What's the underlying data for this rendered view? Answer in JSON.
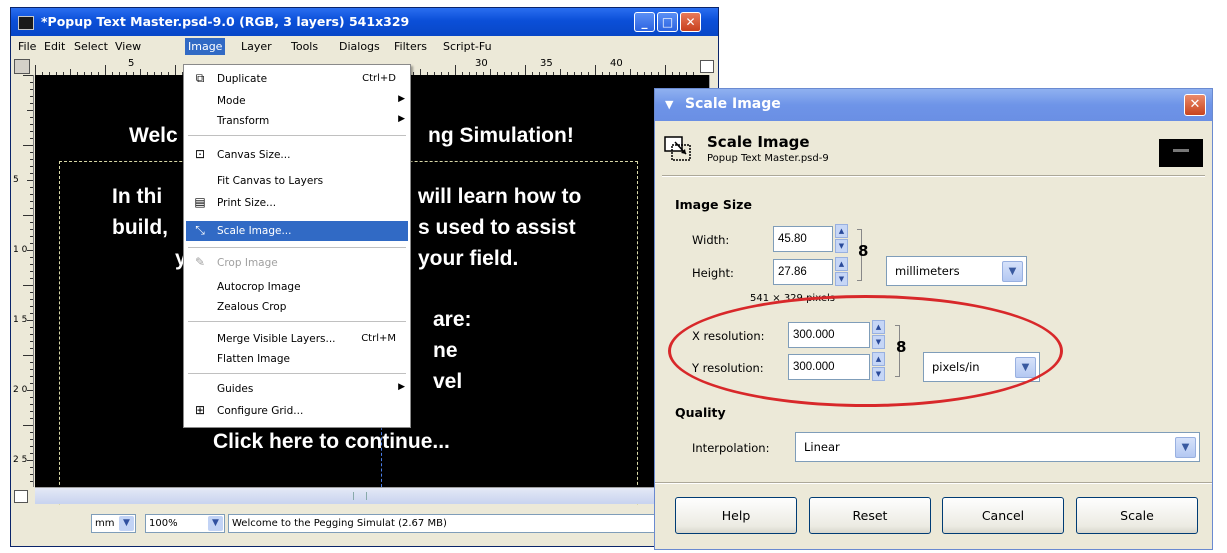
{
  "gimp_window": {
    "title": "*Popup Text Master.psd-9.0 (RGB, 3 layers) 541x329",
    "menu": [
      "File",
      "Edit",
      "Select",
      "View",
      "Image",
      "Layer",
      "Tools",
      "Dialogs",
      "Filters",
      "Script-Fu"
    ],
    "active_menu": "Image",
    "ruler_labels": [
      "5",
      "30",
      "35",
      "40"
    ],
    "left_ruler_labels": [
      "5",
      "1 0",
      "1 5",
      "2 0",
      "2 5"
    ],
    "canvas_lines": [
      "Welc",
      "ng Simulation!",
      "In thi",
      "will learn how to",
      "build,",
      "s used to assist",
      "y",
      "your field.",
      "are:",
      "ne",
      "vel",
      "Click here to continue..."
    ],
    "status": {
      "unit": "mm",
      "zoom": "100%",
      "message": "Welcome to the Pegging Simulat (2.67 MB)"
    }
  },
  "image_menu": {
    "items": [
      {
        "label": "Duplicate",
        "shortcut": "Ctrl+D",
        "icon": "duplicate-icon",
        "glyph": "⧉"
      },
      {
        "label": "Mode",
        "submenu": true
      },
      {
        "label": "Transform",
        "submenu": true
      },
      {
        "label": "Canvas Size...",
        "icon": "canvas-size-icon",
        "glyph": "⊡"
      },
      {
        "label": "Fit Canvas to Layers"
      },
      {
        "label": "Print Size...",
        "icon": "print-size-icon",
        "glyph": "▤"
      },
      {
        "label": "Scale Image...",
        "icon": "scale-image-icon",
        "glyph": "⤡",
        "highlighted": true
      },
      {
        "label": "Crop Image",
        "icon": "crop-icon",
        "glyph": "✎",
        "disabled": true
      },
      {
        "label": "Autocrop Image"
      },
      {
        "label": "Zealous Crop"
      },
      {
        "label": "Merge Visible Layers...",
        "shortcut": "Ctrl+M"
      },
      {
        "label": "Flatten Image"
      },
      {
        "label": "Guides",
        "submenu": true
      },
      {
        "label": "Configure Grid...",
        "icon": "grid-icon",
        "glyph": "⊞"
      }
    ]
  },
  "scale_dialog": {
    "title": "Scale Image",
    "header_title": "Scale Image",
    "header_subtitle": "Popup Text Master.psd-9",
    "image_size_label": "Image Size",
    "width_label": "Width:",
    "width_value": "45.80",
    "height_label": "Height:",
    "height_value": "27.86",
    "size_unit": "millimeters",
    "pixel_info": "541 × 329 pixels",
    "x_res_label": "X resolution:",
    "x_res_value": "300.000",
    "y_res_label": "Y resolution:",
    "y_res_value": "300.000",
    "res_unit": "pixels/in",
    "quality_label": "Quality",
    "interp_label": "Interpolation:",
    "interp_value": "Linear",
    "buttons": {
      "help": "Help",
      "reset": "Reset",
      "cancel": "Cancel",
      "scale": "Scale"
    }
  },
  "colors": {
    "highlight": "#316ac5",
    "annotation_oval": "#d8282a",
    "title_blue": "#0b4fd8"
  }
}
